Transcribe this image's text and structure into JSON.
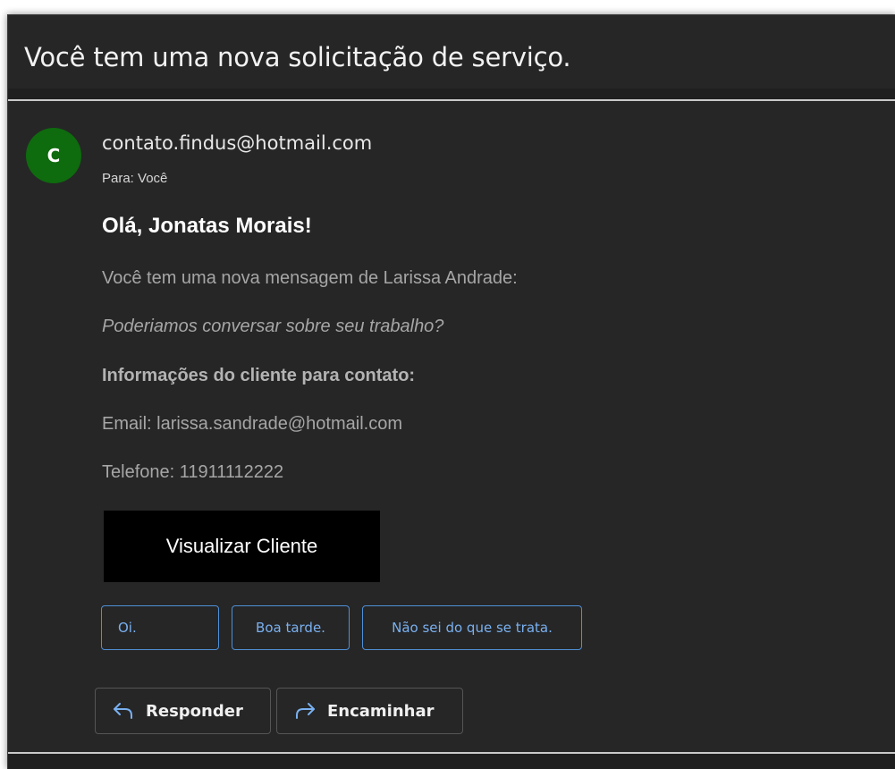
{
  "email": {
    "subject": "Você tem uma nova solicitação de serviço.",
    "sender": {
      "avatar_initial": "C",
      "avatar_color": "#0e6b0e",
      "address": "contato.findus@hotmail.com"
    },
    "to": "Para:  Você",
    "body": {
      "greeting": "Olá, Jonatas Morais!",
      "intro": "Você tem uma nova mensagem de Larissa Andrade:",
      "message": "Poderiamos conversar sobre seu trabalho?",
      "contact_heading": "Informações do cliente para contato:",
      "email_line": "Email: larissa.sandrade@hotmail.com",
      "phone_line": "Telefone: 11911112222",
      "cta_label": "Visualizar Cliente"
    },
    "suggested_replies": [
      "Oi.",
      "Boa tarde.",
      "Não sei do que se trata."
    ],
    "actions": {
      "reply_label": "Responder",
      "reply_icon": "reply-arrow-icon",
      "forward_label": "Encaminhar",
      "forward_icon": "forward-arrow-icon"
    }
  },
  "colors": {
    "background": "#262626",
    "accent": "#4f8fd6",
    "cta_background": "#000000"
  }
}
